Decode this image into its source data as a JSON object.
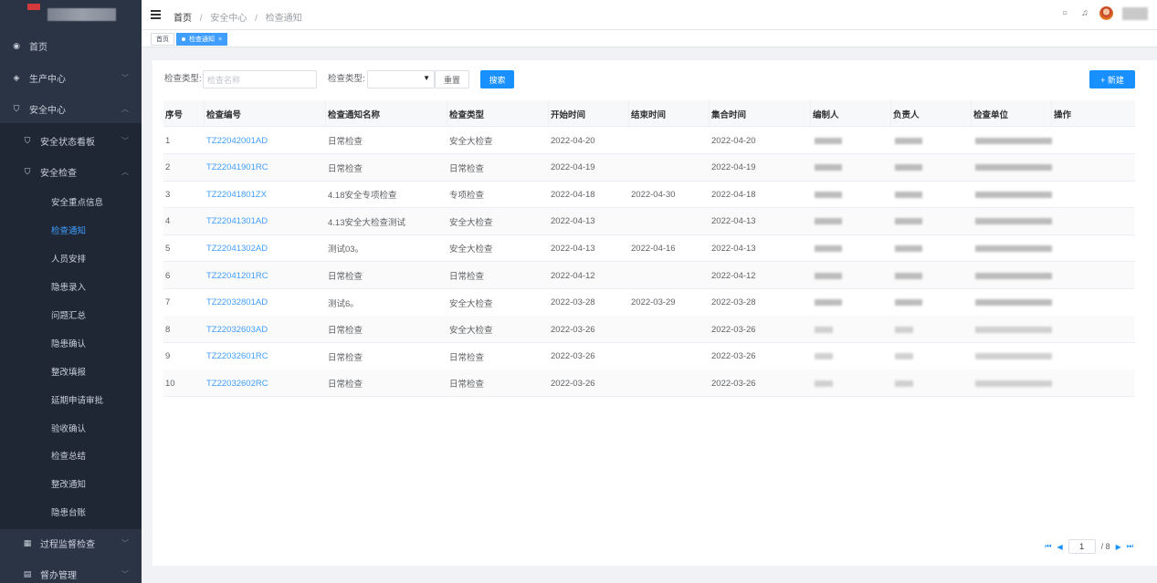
{
  "sidebar": {
    "items": [
      {
        "label": "首页",
        "icon": "dashboard-icon"
      },
      {
        "label": "生产中心",
        "icon": "layers-icon"
      },
      {
        "label": "安全中心",
        "icon": "shield-icon"
      },
      {
        "label": "安全状态看板",
        "icon": "shield-icon"
      },
      {
        "label": "安全检查",
        "icon": "shield-icon"
      },
      {
        "label": "过程监督检查",
        "icon": "calendar-icon"
      },
      {
        "label": "督办管理",
        "icon": "document-icon"
      }
    ],
    "subitems": [
      "安全重点信息",
      "检查通知",
      "人员安排",
      "隐患录入",
      "问题汇总",
      "隐患确认",
      "整改填报",
      "延期申请审批",
      "验收确认",
      "检查总结",
      "整改通知",
      "隐患台账"
    ],
    "active_subitem": "检查通知"
  },
  "header": {
    "breadcrumb": [
      "首页",
      "安全中心",
      "检查通知"
    ]
  },
  "tabs": [
    {
      "label": "首页",
      "active": false
    },
    {
      "label": "检查通知",
      "active": true
    }
  ],
  "filters": {
    "label1": "检查类型:",
    "input_placeholder": "检查名称",
    "label2": "检查类型:",
    "reset_label": "重置",
    "search_label": "搜索",
    "new_label": "+ 新建"
  },
  "table": {
    "columns": [
      "序号",
      "检查编号",
      "检查通知名称",
      "检查类型",
      "开始时间",
      "结束时间",
      "集合时间",
      "编制人",
      "负责人",
      "检查单位",
      "操作"
    ],
    "rows": [
      {
        "no": "1",
        "code": "TZ22042001AD",
        "name": "日常检查",
        "type": "安全大检查",
        "start": "2022-04-20",
        "end": "",
        "gather": "2022-04-20"
      },
      {
        "no": "2",
        "code": "TZ22041901RC",
        "name": "日常检查",
        "type": "日常检查",
        "start": "2022-04-19",
        "end": "",
        "gather": "2022-04-19"
      },
      {
        "no": "3",
        "code": "TZ22041801ZX",
        "name": "4.18安全专项检查",
        "type": "专项检查",
        "start": "2022-04-18",
        "end": "2022-04-30",
        "gather": "2022-04-18"
      },
      {
        "no": "4",
        "code": "TZ22041301AD",
        "name": "4.13安全大检查测试",
        "type": "安全大检查",
        "start": "2022-04-13",
        "end": "",
        "gather": "2022-04-13"
      },
      {
        "no": "5",
        "code": "TZ22041302AD",
        "name": "测试03。",
        "type": "安全大检查",
        "start": "2022-04-13",
        "end": "2022-04-16",
        "gather": "2022-04-13"
      },
      {
        "no": "6",
        "code": "TZ22041201RC",
        "name": "日常检查",
        "type": "日常检查",
        "start": "2022-04-12",
        "end": "",
        "gather": "2022-04-12"
      },
      {
        "no": "7",
        "code": "TZ22032801AD",
        "name": "测试6。",
        "type": "安全大检查",
        "start": "2022-03-28",
        "end": "2022-03-29",
        "gather": "2022-03-28"
      },
      {
        "no": "8",
        "code": "TZ22032603AD",
        "name": "日常检查",
        "type": "安全大检查",
        "start": "2022-03-26",
        "end": "",
        "gather": "2022-03-26"
      },
      {
        "no": "9",
        "code": "TZ22032601RC",
        "name": "日常检查",
        "type": "日常检查",
        "start": "2022-03-26",
        "end": "",
        "gather": "2022-03-26"
      },
      {
        "no": "10",
        "code": "TZ22032602RC",
        "name": "日常检查",
        "type": "日常检查",
        "start": "2022-03-26",
        "end": "",
        "gather": "2022-03-26"
      }
    ]
  },
  "pagination": {
    "current": "1",
    "total_text": "/ 8"
  },
  "colors": {
    "sidebar_bg": "#2b3445",
    "accent": "#1890ff",
    "link": "#409eff"
  }
}
